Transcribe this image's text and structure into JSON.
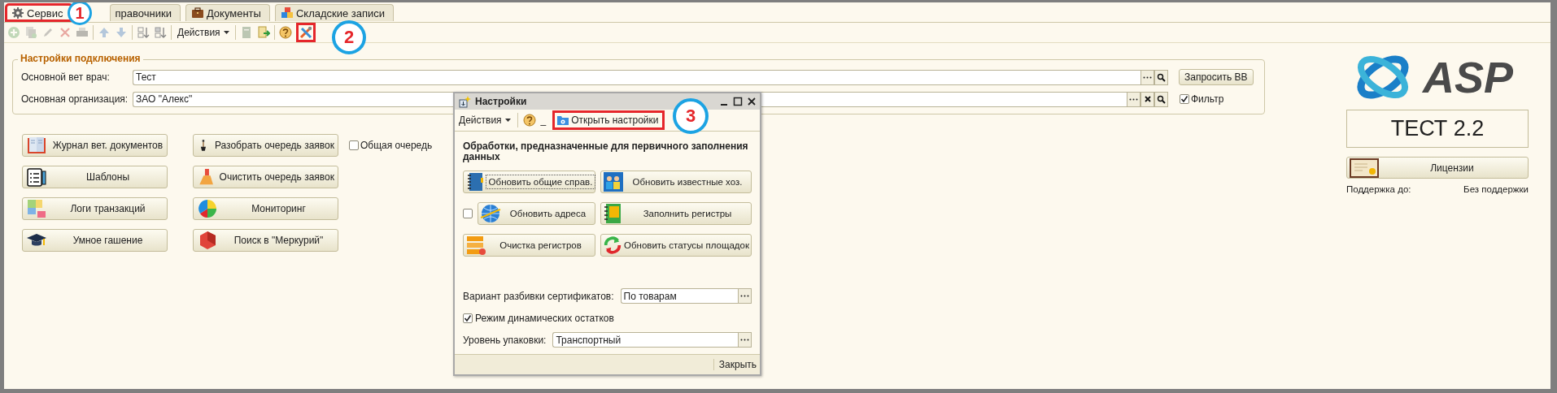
{
  "tabs": [
    {
      "label": "Сервис",
      "selected": true,
      "highlighted": true
    },
    {
      "label": "правочники",
      "selected": false,
      "highlighted": false
    },
    {
      "label": "Документы",
      "selected": false,
      "highlighted": false
    },
    {
      "label": "Складские записи",
      "selected": false,
      "highlighted": false
    }
  ],
  "toolbar": [
    {
      "kind": "button",
      "disabled": true,
      "highlighted": false
    },
    {
      "kind": "button",
      "disabled": true,
      "highlighted": false
    },
    {
      "kind": "button",
      "disabled": true,
      "highlighted": false
    },
    {
      "kind": "button",
      "disabled": true,
      "highlighted": false
    },
    {
      "kind": "button",
      "disabled": true,
      "highlighted": false
    },
    {
      "kind": "separator"
    },
    {
      "kind": "button",
      "disabled": true,
      "highlighted": false
    },
    {
      "kind": "button",
      "disabled": true,
      "highlighted": false
    },
    {
      "kind": "separator"
    },
    {
      "kind": "button",
      "disabled": false,
      "highlighted": false
    },
    {
      "kind": "button",
      "disabled": false,
      "highlighted": false
    },
    {
      "kind": "separator"
    },
    {
      "kind": "menu",
      "label": "Действия"
    },
    {
      "kind": "separator"
    },
    {
      "kind": "button",
      "disabled": true,
      "highlighted": false
    },
    {
      "kind": "button",
      "disabled": false,
      "highlighted": false
    },
    {
      "kind": "separator"
    },
    {
      "kind": "button",
      "disabled": false,
      "highlighted": false
    },
    {
      "kind": "button",
      "disabled": false,
      "highlighted": true
    }
  ],
  "connection_settings": {
    "title": "Настройки подключения",
    "fields": [
      {
        "kind": "lookup",
        "label": "Основной вет врач:",
        "value": "Тест"
      },
      {
        "kind": "clearable",
        "label": "Основная организация:",
        "value": "ЗАО \"Алекс\""
      }
    ],
    "request_button": "Запросить ВВ",
    "filter": {
      "label": "Фильтр",
      "checked": true
    }
  },
  "actions": [
    {
      "label": "Журнал вет. документов"
    },
    {
      "label": "Разобрать очередь заявок"
    },
    {
      "label": "Шаблоны"
    },
    {
      "label": "Очистить очередь заявок"
    },
    {
      "label": "Логи транзакций"
    },
    {
      "label": "Мониторинг"
    },
    {
      "label": "Умное гашение"
    },
    {
      "label": "Поиск в \"Меркурий\""
    }
  ],
  "shared_queue": {
    "label": "Общая очередь",
    "checked": false
  },
  "logo": {
    "text": "ASP"
  },
  "version": "ТЕСТ 2.2",
  "licenses_button": "Лицензии",
  "support": {
    "label": "Поддержка до:",
    "value": "Без поддержки"
  },
  "dialog": {
    "title": "Настройки",
    "toolbar": {
      "menu": "Действия",
      "mark": "_",
      "button": {
        "label": "Открыть настройки",
        "highlighted": true
      }
    },
    "heading": "Обработки, предназначенные для первичного заполнения данных",
    "actions": [
      {
        "kind": "button",
        "label": "Обновить общие справ.",
        "focused": true
      },
      {
        "kind": "button",
        "label": "Обновить известные хоз.",
        "focused": false
      },
      {
        "kind": "toggle",
        "label": "Обновить адреса",
        "checked": false,
        "focused": false
      },
      {
        "kind": "button",
        "label": "Заполнить регистры",
        "focused": false
      },
      {
        "kind": "button",
        "label": "Очистка регистров",
        "focused": false
      },
      {
        "kind": "button",
        "label": "Обновить статусы площадок",
        "focused": false
      }
    ],
    "split_field": {
      "label": "Вариант разбивки сертификатов:",
      "value": "По товарам"
    },
    "dynamic_stock": {
      "label": "Режим динамических остатков",
      "checked": true
    },
    "package_field": {
      "label": "Уровень упаковки:",
      "value": "Транспортный"
    },
    "close_button": "Закрыть"
  },
  "callouts": [
    {
      "label": "1"
    },
    {
      "label": "2"
    },
    {
      "label": "3"
    }
  ]
}
